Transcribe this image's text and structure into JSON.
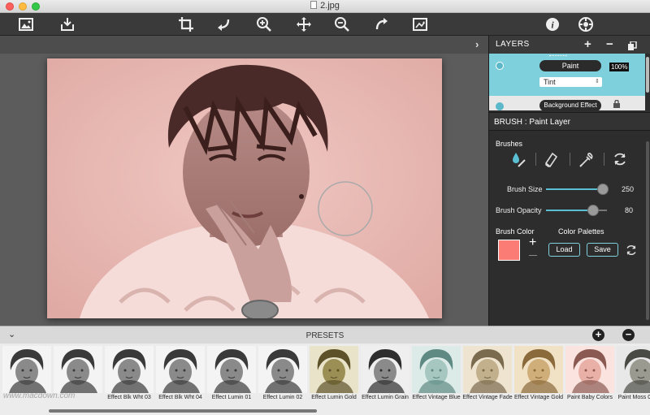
{
  "window": {
    "title": "2.jpg"
  },
  "toolbar": {
    "icons": [
      "open-image-icon",
      "save-icon",
      "crop-icon",
      "undo-icon",
      "zoom-in-icon",
      "pan-icon",
      "zoom-out-icon",
      "redo-icon",
      "export-icon",
      "info-icon",
      "settings-icon"
    ]
  },
  "layers": {
    "title": "LAYERS",
    "add": "+",
    "remove": "−",
    "items": [
      {
        "name": "Paint",
        "opacity": "100%",
        "mode": "Tint"
      },
      {
        "name": "Background Effect"
      }
    ]
  },
  "brush": {
    "title": "BRUSH : Paint Layer",
    "brushes_label": "Brushes",
    "size_label": "Brush Size",
    "size_value": "250",
    "size_fraction": 0.93,
    "opacity_label": "Brush Opacity",
    "opacity_value": "80",
    "opacity_fraction": 0.78,
    "color_label": "Brush Color",
    "color": "#fb7c74",
    "palettes_label": "Color Palettes",
    "add": "+",
    "load": "Load",
    "save": "Save"
  },
  "presets": {
    "title": "PRESETS",
    "items": [
      {
        "label": "",
        "tone": "bw"
      },
      {
        "label": "",
        "tone": "bw"
      },
      {
        "label": "Effect Blk Wht 03",
        "tone": "bw"
      },
      {
        "label": "Effect Blk Wht 04",
        "tone": "bw"
      },
      {
        "label": "Effect Lumin 01",
        "tone": "bw"
      },
      {
        "label": "Effect Lumin 02",
        "tone": "bw"
      },
      {
        "label": "Effect Lumin Gold",
        "tone": "gold"
      },
      {
        "label": "Effect Lumin Grain",
        "tone": "grain"
      },
      {
        "label": "Effect Vintage Blue",
        "tone": "blue"
      },
      {
        "label": "Effect Vintage Fade",
        "tone": "fade"
      },
      {
        "label": "Effect Vintage Gold",
        "tone": "vgold"
      },
      {
        "label": "Paint Baby Colors",
        "tone": "baby"
      },
      {
        "label": "Paint Moss Colors",
        "tone": "moss"
      }
    ],
    "watermark": "www.macdown.com"
  },
  "colors": {
    "accent": "#5bbfd4",
    "layer_selected": "#7fd0dd",
    "photo_tint": "#e8b7b2"
  }
}
